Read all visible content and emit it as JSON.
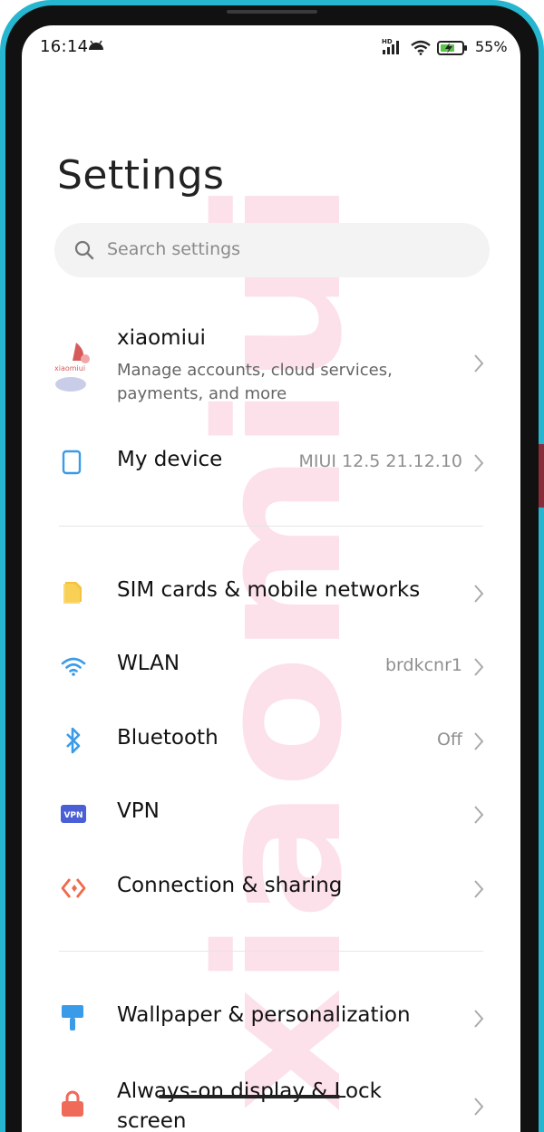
{
  "status_bar": {
    "time": "16:14",
    "network": "HD",
    "battery_percent": "55%"
  },
  "page": {
    "title": "Settings"
  },
  "search": {
    "placeholder": "Search settings"
  },
  "watermark": {
    "text": "xiaomiui"
  },
  "account": {
    "logo_text": "xiaomiui",
    "name": "xiaomiui",
    "subtitle": "Manage accounts, cloud services, payments, and more"
  },
  "items": [
    {
      "key": "my-device",
      "label": "My device",
      "value": "MIUI 12.5 21.12.10",
      "icon": "phone-icon"
    },
    {
      "key": "sim-cards",
      "label": "SIM cards & mobile networks",
      "value": "",
      "icon": "sim-card-icon"
    },
    {
      "key": "wlan",
      "label": "WLAN",
      "value": "brdkcnr1",
      "icon": "wifi-icon"
    },
    {
      "key": "bluetooth",
      "label": "Bluetooth",
      "value": "Off",
      "icon": "bluetooth-icon"
    },
    {
      "key": "vpn",
      "label": "VPN",
      "value": "",
      "icon": "vpn-icon",
      "icon_text": "VPN"
    },
    {
      "key": "connection-sharing",
      "label": "Connection & sharing",
      "value": "",
      "icon": "connection-sharing-icon"
    },
    {
      "key": "wallpaper",
      "label": "Wallpaper & personalization",
      "value": "",
      "icon": "paint-roller-icon"
    },
    {
      "key": "always-on",
      "label": "Always-on display & Lock screen",
      "value": "",
      "icon": "lock-icon"
    }
  ],
  "colors": {
    "frame_accent": "#27b6cf",
    "icon_blue": "#3a9be8",
    "icon_yellow": "#f5c33b",
    "icon_vpn": "#4a5fd6",
    "icon_orange": "#f06a4a",
    "icon_lock": "#f06a5a",
    "watermark_pink": "#f9c6d8"
  }
}
